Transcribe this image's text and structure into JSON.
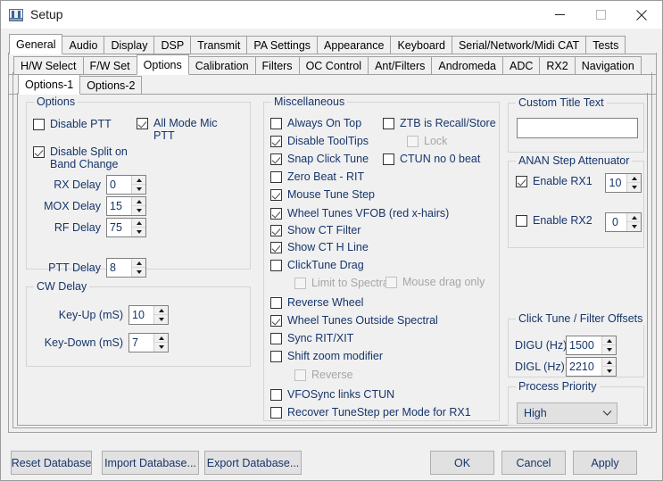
{
  "window": {
    "title": "Setup",
    "icon": "setup-window-icon",
    "controls": {
      "minimize": "minimize-icon",
      "maximize": "maximize-icon",
      "close": "close-icon"
    }
  },
  "tabs_row1": [
    {
      "label": "General",
      "active": true
    },
    {
      "label": "Audio",
      "active": false
    },
    {
      "label": "Display",
      "active": false
    },
    {
      "label": "DSP",
      "active": false
    },
    {
      "label": "Transmit",
      "active": false
    },
    {
      "label": "PA Settings",
      "active": false
    },
    {
      "label": "Appearance",
      "active": false
    },
    {
      "label": "Keyboard",
      "active": false
    },
    {
      "label": "Serial/Network/Midi CAT",
      "active": false
    },
    {
      "label": "Tests",
      "active": false
    }
  ],
  "tabs_row2": [
    {
      "label": "H/W Select",
      "active": false
    },
    {
      "label": "F/W Set",
      "active": false
    },
    {
      "label": "Options",
      "active": true
    },
    {
      "label": "Calibration",
      "active": false
    },
    {
      "label": "Filters",
      "active": false
    },
    {
      "label": "OC Control",
      "active": false
    },
    {
      "label": "Ant/Filters",
      "active": false
    },
    {
      "label": "Andromeda",
      "active": false
    },
    {
      "label": "ADC",
      "active": false
    },
    {
      "label": "RX2",
      "active": false
    },
    {
      "label": "Navigation",
      "active": false
    }
  ],
  "tabs_row3": [
    {
      "label": "Options-1",
      "active": true
    },
    {
      "label": "Options-2",
      "active": false
    }
  ],
  "options_group": {
    "title": "Options",
    "disable_ptt": {
      "label": "Disable PTT",
      "checked": false
    },
    "all_mode_mic_ptt": {
      "label_line1": "All Mode Mic",
      "label_line2": "PTT",
      "checked": true
    },
    "disable_split": {
      "label_line1": "Disable Split on",
      "label_line2": "Band Change",
      "checked": true
    },
    "delays": [
      {
        "label": "RX Delay",
        "value": "0"
      },
      {
        "label": "MOX Delay",
        "value": "15"
      },
      {
        "label": "RF Delay",
        "value": "75"
      },
      {
        "label": "PTT Delay",
        "value": "8"
      }
    ]
  },
  "cw_delay_group": {
    "title": "CW Delay",
    "rows": [
      {
        "label": "Key-Up (mS)",
        "value": "10"
      },
      {
        "label": "Key-Down (mS)",
        "value": "7"
      }
    ]
  },
  "misc_group": {
    "title": "Miscellaneous",
    "left_column": [
      {
        "label": "Always On Top",
        "checked": false,
        "disabled": false,
        "indent": 0
      },
      {
        "label": "Disable ToolTips",
        "checked": true,
        "disabled": false,
        "indent": 0
      },
      {
        "label": "Snap Click Tune",
        "checked": true,
        "disabled": false,
        "indent": 0
      },
      {
        "label": "Zero Beat -  RIT",
        "checked": false,
        "disabled": false,
        "indent": 0
      },
      {
        "label": "Mouse Tune Step",
        "checked": true,
        "disabled": false,
        "indent": 0
      },
      {
        "label": "Wheel Tunes VFOB (red x-hairs)",
        "checked": true,
        "disabled": false,
        "indent": 0
      },
      {
        "label": "Show CT Filter",
        "checked": true,
        "disabled": false,
        "indent": 0
      },
      {
        "label": "Show CT H Line",
        "checked": true,
        "disabled": false,
        "indent": 0
      },
      {
        "label": "ClickTune Drag",
        "checked": false,
        "disabled": false,
        "indent": 0
      },
      {
        "label": "Limit to Spectral",
        "checked": false,
        "disabled": true,
        "indent": 1
      },
      {
        "label": "Reverse Wheel",
        "checked": false,
        "disabled": false,
        "indent": 0
      },
      {
        "label": "Wheel Tunes Outside Spectral",
        "checked": true,
        "disabled": false,
        "indent": 0
      },
      {
        "label": "Sync RIT/XIT",
        "checked": false,
        "disabled": false,
        "indent": 0
      },
      {
        "label": "Shift zoom modifier",
        "checked": false,
        "disabled": false,
        "indent": 0
      },
      {
        "label": "Reverse",
        "checked": false,
        "disabled": true,
        "indent": 1
      },
      {
        "label": "VFOSync links CTUN",
        "checked": false,
        "disabled": false,
        "indent": 0
      },
      {
        "label": "Recover TuneStep per Mode for RX1",
        "checked": false,
        "disabled": false,
        "indent": 0
      }
    ],
    "right_column": [
      {
        "label": "ZTB is Recall/Store",
        "checked": false,
        "disabled": false,
        "indent": 0
      },
      {
        "label": "Lock",
        "checked": false,
        "disabled": true,
        "indent": 1
      },
      {
        "label": "CTUN no 0 beat",
        "checked": false,
        "disabled": false,
        "indent": 0
      }
    ],
    "mouse_drag_only": {
      "label": "Mouse drag only",
      "checked": false,
      "disabled": true
    }
  },
  "custom_title_group": {
    "title": "Custom Title Text",
    "value": "",
    "placeholder": ""
  },
  "atten_group": {
    "title": "ANAN Step Attenuator",
    "rx1": {
      "label": "Enable RX1",
      "checked": true,
      "value": "10"
    },
    "rx2": {
      "label": "Enable RX2",
      "checked": false,
      "value": "0"
    }
  },
  "offsets_group": {
    "title": "Click Tune / Filter Offsets",
    "digu": {
      "label": "DIGU (Hz):",
      "value": "1500"
    },
    "digl": {
      "label": "DIGL (Hz):",
      "value": "2210"
    }
  },
  "priority_group": {
    "title": "Process Priority",
    "selected": "High",
    "options": [
      "High"
    ]
  },
  "footer": {
    "reset_database": "Reset Database",
    "import_database": "Import Database...",
    "export_database": "Export Database...",
    "ok": "OK",
    "cancel": "Cancel",
    "apply": "Apply"
  },
  "theme": {
    "window_bg": "#f0f0f0",
    "text_color": "#16356b",
    "border": "#a0a0a0",
    "group_border": "#d4d4d4"
  }
}
